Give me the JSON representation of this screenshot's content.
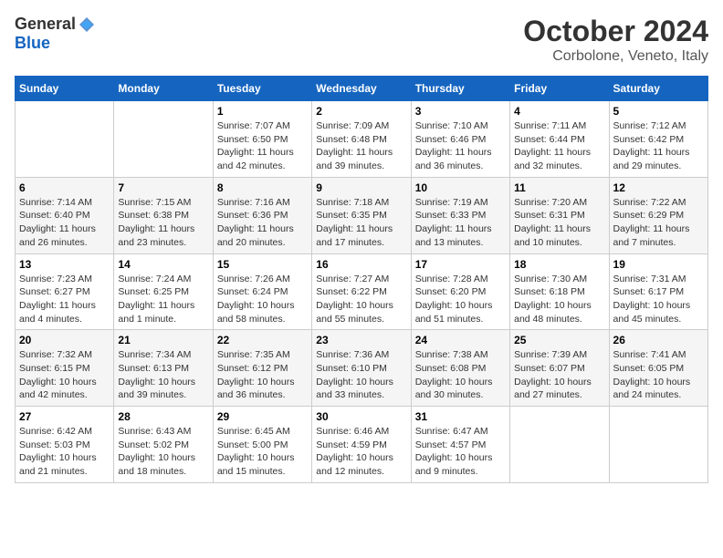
{
  "header": {
    "logo_general": "General",
    "logo_blue": "Blue",
    "month": "October 2024",
    "location": "Corbolone, Veneto, Italy"
  },
  "weekdays": [
    "Sunday",
    "Monday",
    "Tuesday",
    "Wednesday",
    "Thursday",
    "Friday",
    "Saturday"
  ],
  "weeks": [
    [
      {
        "day": "",
        "info": ""
      },
      {
        "day": "",
        "info": ""
      },
      {
        "day": "1",
        "info": "Sunrise: 7:07 AM\nSunset: 6:50 PM\nDaylight: 11 hours and 42 minutes."
      },
      {
        "day": "2",
        "info": "Sunrise: 7:09 AM\nSunset: 6:48 PM\nDaylight: 11 hours and 39 minutes."
      },
      {
        "day": "3",
        "info": "Sunrise: 7:10 AM\nSunset: 6:46 PM\nDaylight: 11 hours and 36 minutes."
      },
      {
        "day": "4",
        "info": "Sunrise: 7:11 AM\nSunset: 6:44 PM\nDaylight: 11 hours and 32 minutes."
      },
      {
        "day": "5",
        "info": "Sunrise: 7:12 AM\nSunset: 6:42 PM\nDaylight: 11 hours and 29 minutes."
      }
    ],
    [
      {
        "day": "6",
        "info": "Sunrise: 7:14 AM\nSunset: 6:40 PM\nDaylight: 11 hours and 26 minutes."
      },
      {
        "day": "7",
        "info": "Sunrise: 7:15 AM\nSunset: 6:38 PM\nDaylight: 11 hours and 23 minutes."
      },
      {
        "day": "8",
        "info": "Sunrise: 7:16 AM\nSunset: 6:36 PM\nDaylight: 11 hours and 20 minutes."
      },
      {
        "day": "9",
        "info": "Sunrise: 7:18 AM\nSunset: 6:35 PM\nDaylight: 11 hours and 17 minutes."
      },
      {
        "day": "10",
        "info": "Sunrise: 7:19 AM\nSunset: 6:33 PM\nDaylight: 11 hours and 13 minutes."
      },
      {
        "day": "11",
        "info": "Sunrise: 7:20 AM\nSunset: 6:31 PM\nDaylight: 11 hours and 10 minutes."
      },
      {
        "day": "12",
        "info": "Sunrise: 7:22 AM\nSunset: 6:29 PM\nDaylight: 11 hours and 7 minutes."
      }
    ],
    [
      {
        "day": "13",
        "info": "Sunrise: 7:23 AM\nSunset: 6:27 PM\nDaylight: 11 hours and 4 minutes."
      },
      {
        "day": "14",
        "info": "Sunrise: 7:24 AM\nSunset: 6:25 PM\nDaylight: 11 hours and 1 minute."
      },
      {
        "day": "15",
        "info": "Sunrise: 7:26 AM\nSunset: 6:24 PM\nDaylight: 10 hours and 58 minutes."
      },
      {
        "day": "16",
        "info": "Sunrise: 7:27 AM\nSunset: 6:22 PM\nDaylight: 10 hours and 55 minutes."
      },
      {
        "day": "17",
        "info": "Sunrise: 7:28 AM\nSunset: 6:20 PM\nDaylight: 10 hours and 51 minutes."
      },
      {
        "day": "18",
        "info": "Sunrise: 7:30 AM\nSunset: 6:18 PM\nDaylight: 10 hours and 48 minutes."
      },
      {
        "day": "19",
        "info": "Sunrise: 7:31 AM\nSunset: 6:17 PM\nDaylight: 10 hours and 45 minutes."
      }
    ],
    [
      {
        "day": "20",
        "info": "Sunrise: 7:32 AM\nSunset: 6:15 PM\nDaylight: 10 hours and 42 minutes."
      },
      {
        "day": "21",
        "info": "Sunrise: 7:34 AM\nSunset: 6:13 PM\nDaylight: 10 hours and 39 minutes."
      },
      {
        "day": "22",
        "info": "Sunrise: 7:35 AM\nSunset: 6:12 PM\nDaylight: 10 hours and 36 minutes."
      },
      {
        "day": "23",
        "info": "Sunrise: 7:36 AM\nSunset: 6:10 PM\nDaylight: 10 hours and 33 minutes."
      },
      {
        "day": "24",
        "info": "Sunrise: 7:38 AM\nSunset: 6:08 PM\nDaylight: 10 hours and 30 minutes."
      },
      {
        "day": "25",
        "info": "Sunrise: 7:39 AM\nSunset: 6:07 PM\nDaylight: 10 hours and 27 minutes."
      },
      {
        "day": "26",
        "info": "Sunrise: 7:41 AM\nSunset: 6:05 PM\nDaylight: 10 hours and 24 minutes."
      }
    ],
    [
      {
        "day": "27",
        "info": "Sunrise: 6:42 AM\nSunset: 5:03 PM\nDaylight: 10 hours and 21 minutes."
      },
      {
        "day": "28",
        "info": "Sunrise: 6:43 AM\nSunset: 5:02 PM\nDaylight: 10 hours and 18 minutes."
      },
      {
        "day": "29",
        "info": "Sunrise: 6:45 AM\nSunset: 5:00 PM\nDaylight: 10 hours and 15 minutes."
      },
      {
        "day": "30",
        "info": "Sunrise: 6:46 AM\nSunset: 4:59 PM\nDaylight: 10 hours and 12 minutes."
      },
      {
        "day": "31",
        "info": "Sunrise: 6:47 AM\nSunset: 4:57 PM\nDaylight: 10 hours and 9 minutes."
      },
      {
        "day": "",
        "info": ""
      },
      {
        "day": "",
        "info": ""
      }
    ]
  ]
}
